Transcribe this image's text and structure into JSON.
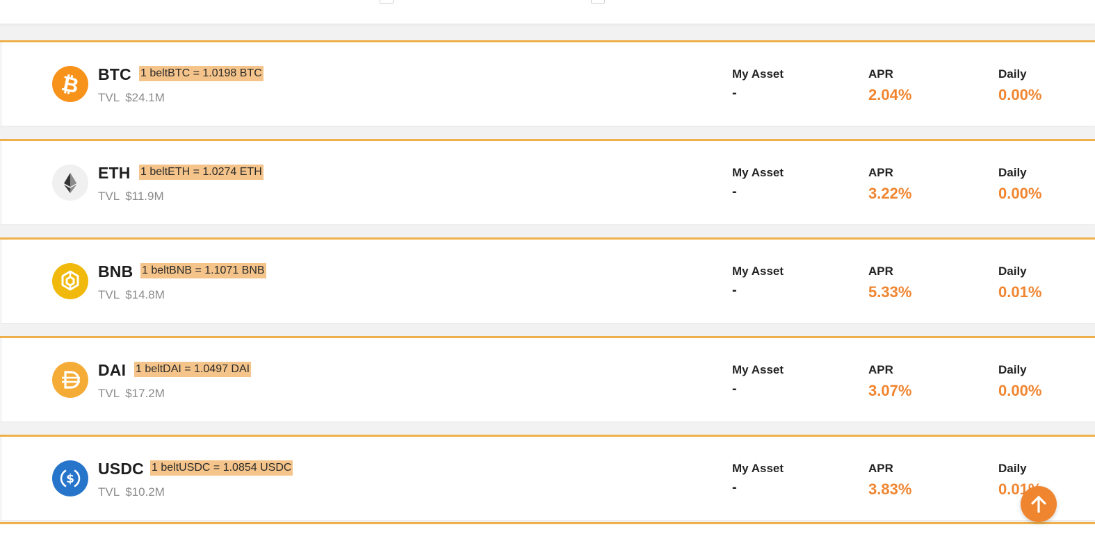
{
  "colors": {
    "accent": "#f08530",
    "card_border": "#eeb04a",
    "badge_bg": "#f5c48a"
  },
  "labels": {
    "my_asset": "My Asset",
    "apr": "APR",
    "daily": "Daily",
    "tvl": "TVL"
  },
  "pools": [
    {
      "symbol": "BTC",
      "icon": "bitcoin-icon",
      "rate": "1 beltBTC = 1.0198 BTC",
      "tvl": "$24.1M",
      "my_asset": "-",
      "apr": "2.04%",
      "daily": "0.00%"
    },
    {
      "symbol": "ETH",
      "icon": "ethereum-icon",
      "rate": "1 beltETH = 1.0274 ETH",
      "tvl": "$11.9M",
      "my_asset": "-",
      "apr": "3.22%",
      "daily": "0.00%"
    },
    {
      "symbol": "BNB",
      "icon": "bnb-icon",
      "rate": "1 beltBNB = 1.1071 BNB",
      "tvl": "$14.8M",
      "my_asset": "-",
      "apr": "5.33%",
      "daily": "0.01%"
    },
    {
      "symbol": "DAI",
      "icon": "dai-icon",
      "rate": "1 beltDAI = 1.0497 DAI",
      "tvl": "$17.2M",
      "my_asset": "-",
      "apr": "3.07%",
      "daily": "0.00%"
    },
    {
      "symbol": "USDC",
      "icon": "usdc-icon",
      "rate": "1 beltUSDC = 1.0854 USDC",
      "tvl": "$10.2M",
      "my_asset": "-",
      "apr": "3.83%",
      "daily": "0.01%"
    }
  ],
  "scroll_top_icon": "arrow-up-icon"
}
